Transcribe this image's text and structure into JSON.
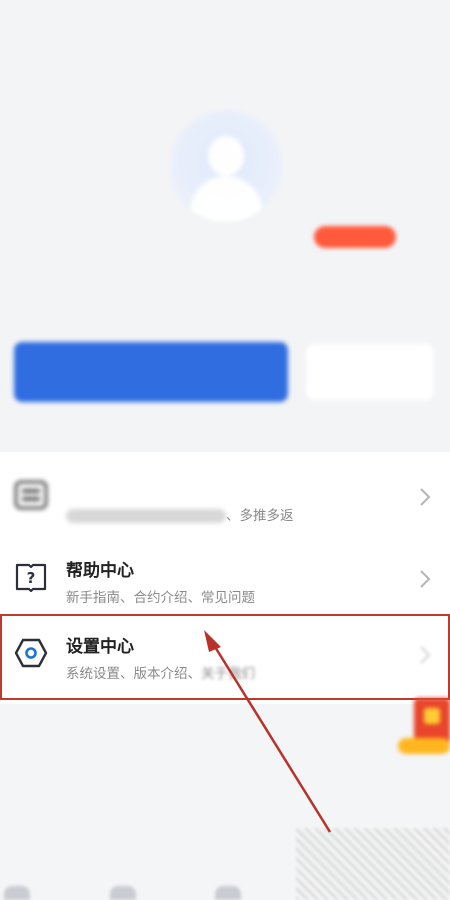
{
  "menu": {
    "items": [
      {
        "title": "",
        "desc_tail": "、多推多返",
        "icon": "list-icon"
      },
      {
        "title": "帮助中心",
        "desc": "新手指南、合约介绍、常见问题",
        "icon": "help-book-icon"
      },
      {
        "title": "设置中心",
        "desc_main": "系统设置、版本介绍、",
        "desc_tail": "关于我们",
        "icon": "settings-hexagon-icon"
      }
    ]
  },
  "colors": {
    "primary": "#2f6de1",
    "badge": "#ff5a3c",
    "highlight": "#c0392b",
    "annotation_arrow": "#b8322a"
  }
}
